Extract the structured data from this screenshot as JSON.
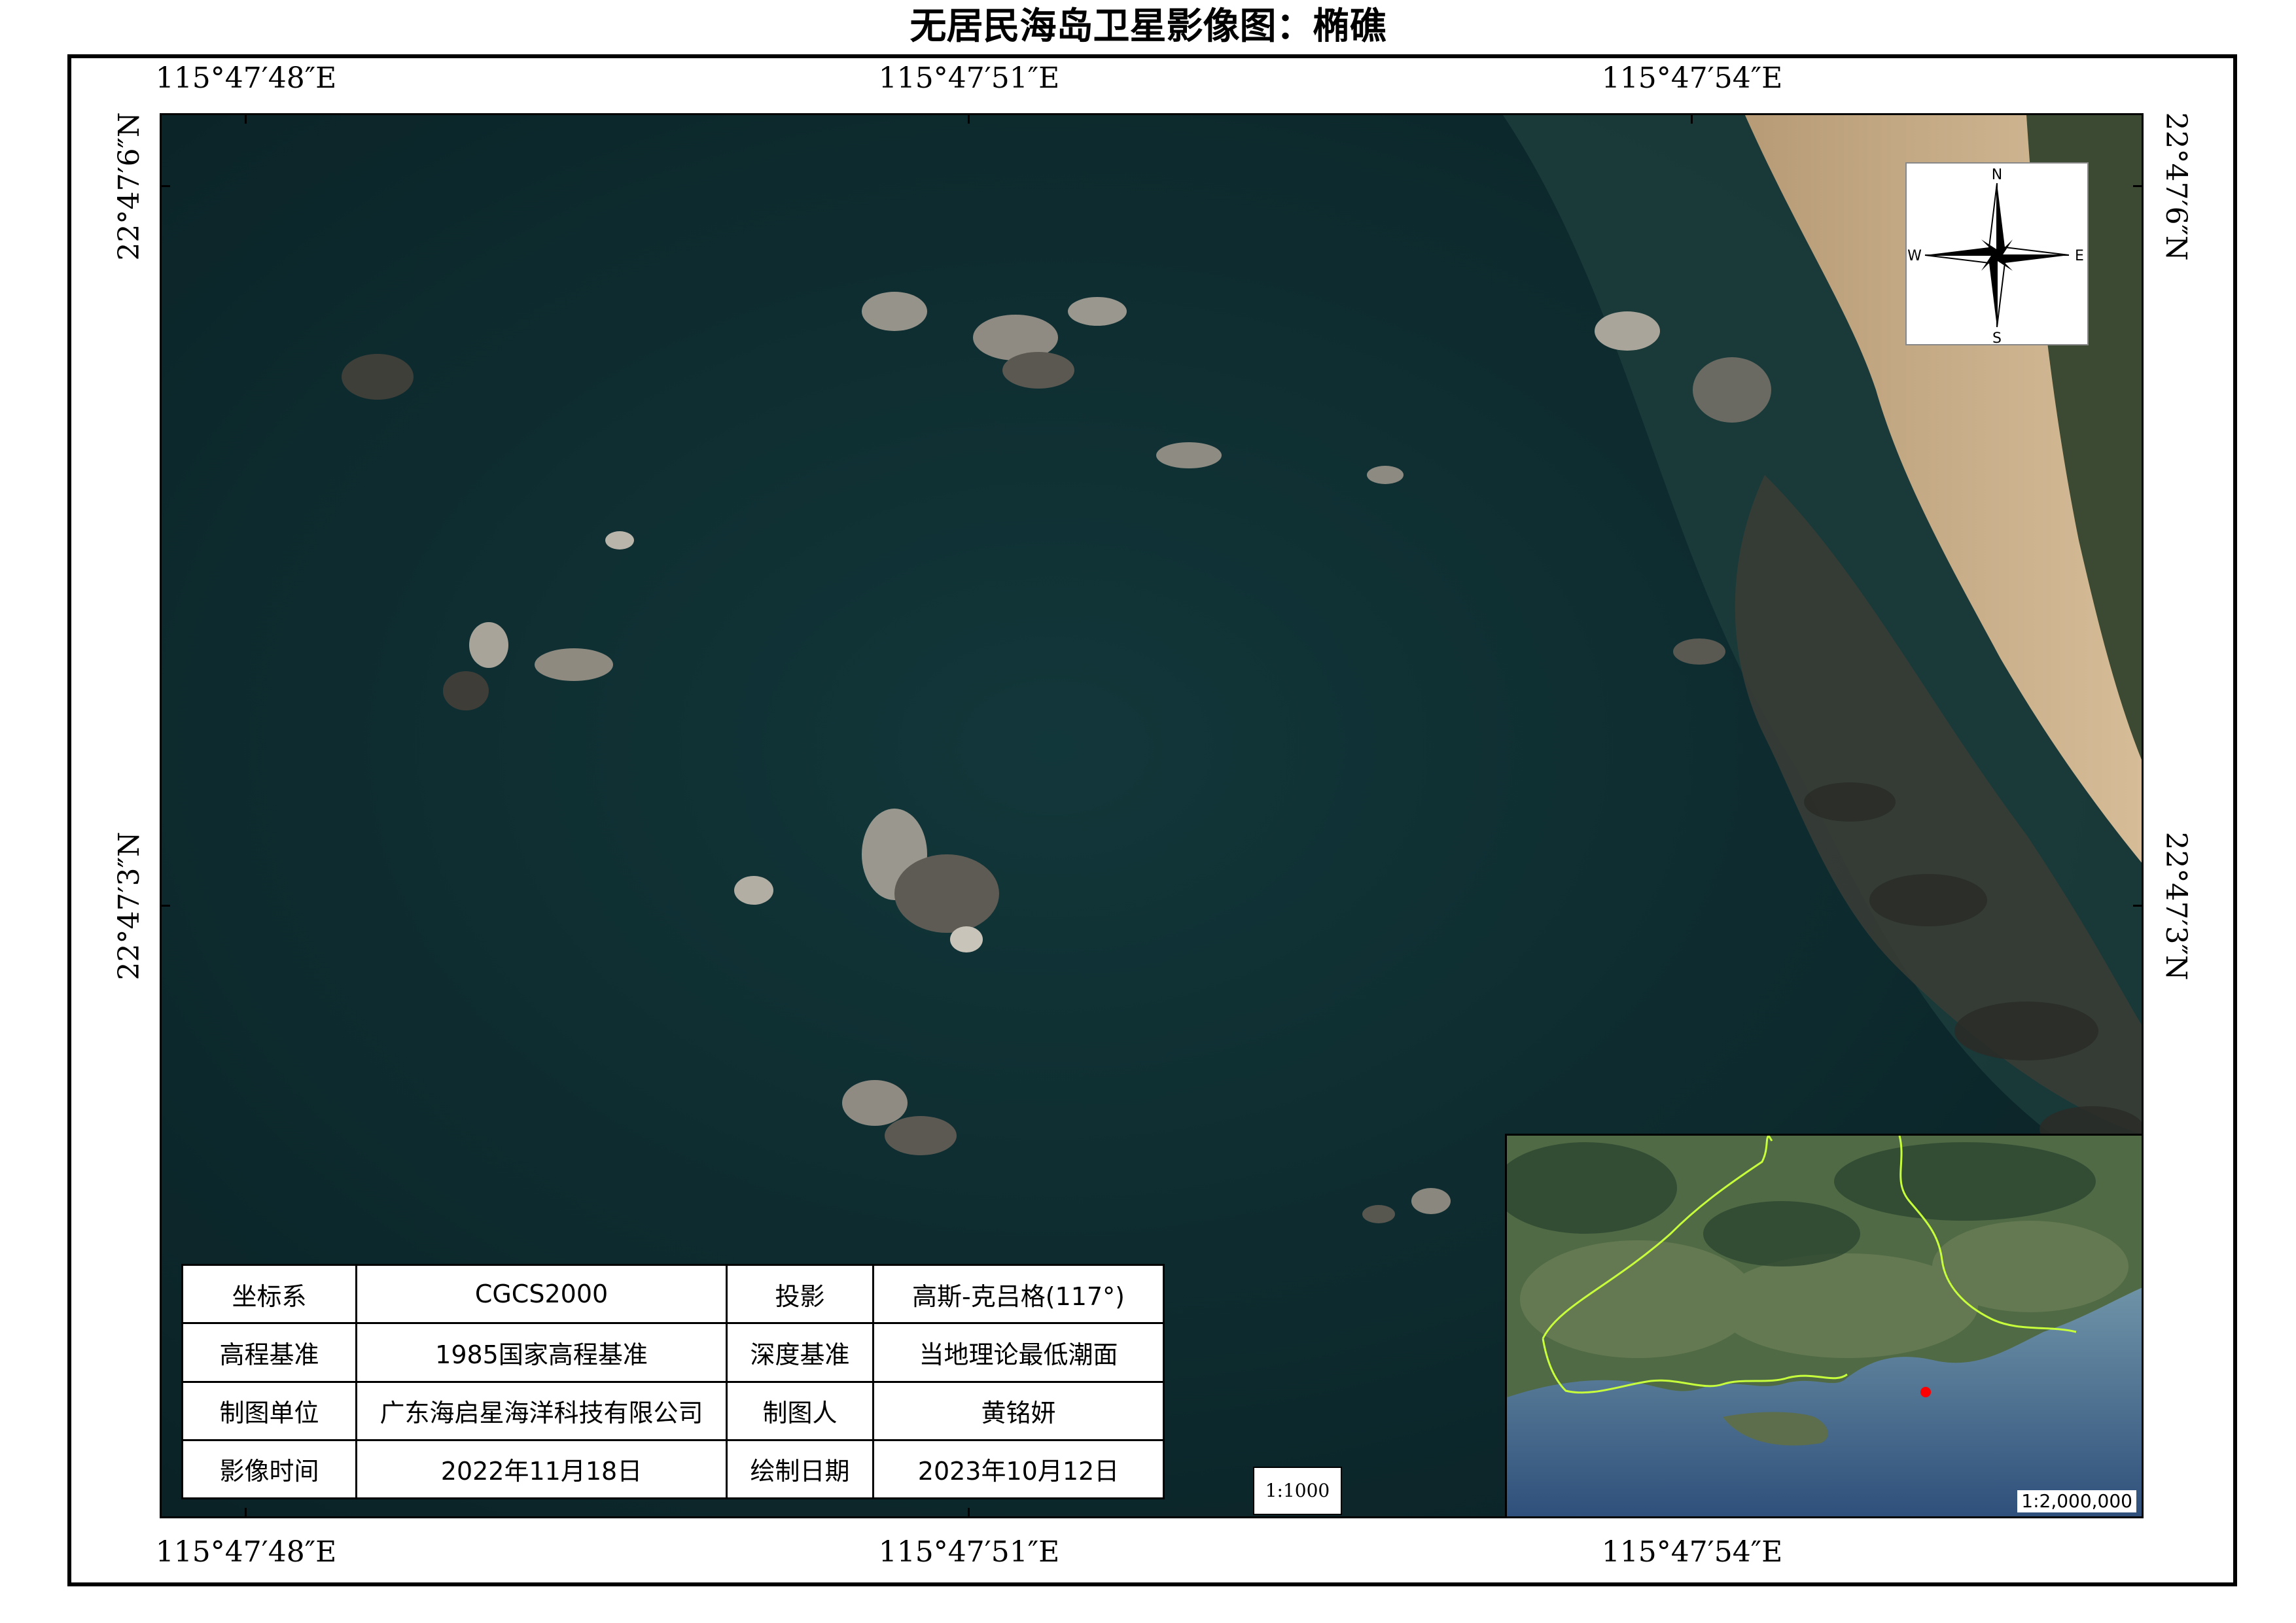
{
  "title": "无居民海岛卫星影像图：椭礁",
  "coordinates": {
    "top": [
      "115°47′48″E",
      "115°47′51″E",
      "115°47′54″E"
    ],
    "bottom": [
      "115°47′48″E",
      "115°47′51″E",
      "115°47′54″E"
    ],
    "left": [
      "22°47′6″N",
      "22°47′3″N"
    ],
    "right": [
      "22°47′6″N",
      "22°47′3″N"
    ]
  },
  "compass": {
    "north": "N",
    "south": "S",
    "east": "E",
    "west": "W",
    "icon": "compass-rose-icon"
  },
  "info_table": [
    [
      "坐标系",
      "CGCS2000",
      "投影",
      "高斯-克吕格(117°)"
    ],
    [
      "高程基准",
      "1985国家高程基准",
      "深度基准",
      "当地理论最低潮面"
    ],
    [
      "制图单位",
      "广东海启星海洋科技有限公司",
      "制图人",
      "黄铭妍"
    ],
    [
      "影像时间",
      "2022年11月18日",
      "绘制日期",
      "2023年10月12日"
    ]
  ],
  "scale": "1:1000",
  "inset": {
    "scale": "1:2,000,000",
    "marker_color": "#ff0000",
    "boundary_color": "#c8ff3c"
  },
  "colors": {
    "sea": "#0e2a2e",
    "beach": "#c8aa82",
    "rock": "#8c8a82",
    "vegetation": "#3c4a34"
  }
}
